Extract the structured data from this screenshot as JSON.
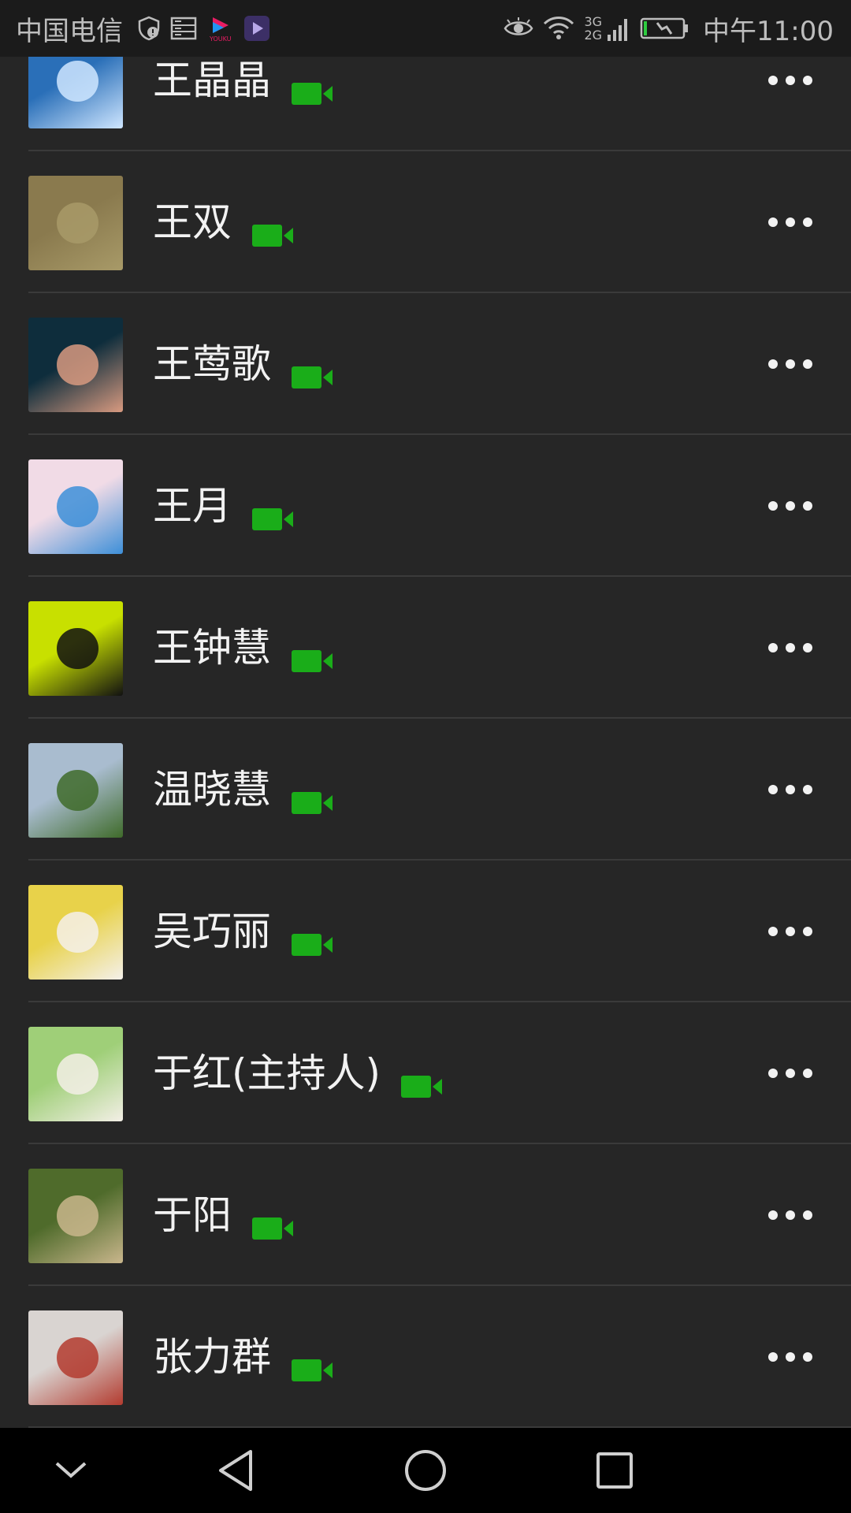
{
  "status_bar": {
    "carrier": "中国电信",
    "network_top": "3G",
    "network_bottom": "2G",
    "time": "中午11:00",
    "icons": [
      "shield-check-icon",
      "storage-icon",
      "youku-app-icon",
      "video-player-app-icon",
      "eye-icon",
      "wifi-icon",
      "signal-icon",
      "battery-charging-icon"
    ]
  },
  "contacts": [
    {
      "name": "王晶晶",
      "avatar": "sky-sun-avatar",
      "avatar_colors": [
        "#2a6fb8",
        "#cfe6ff"
      ]
    },
    {
      "name": "王双",
      "avatar": "grass-shadow-avatar",
      "avatar_colors": [
        "#8a7a4e",
        "#a89a68"
      ]
    },
    {
      "name": "王莺歌",
      "avatar": "fingers-hat-avatar",
      "avatar_colors": [
        "#0e2d3c",
        "#d89a80"
      ]
    },
    {
      "name": "王月",
      "avatar": "doraemon-avatar",
      "avatar_colors": [
        "#f1dbe6",
        "#3d8fd8"
      ]
    },
    {
      "name": "王钟慧",
      "avatar": "cartoon-girl-avatar",
      "avatar_colors": [
        "#c8e000",
        "#111111"
      ]
    },
    {
      "name": "温晓慧",
      "avatar": "sunflower-field-avatar",
      "avatar_colors": [
        "#a9bccf",
        "#3f6b2a"
      ]
    },
    {
      "name": "吴巧丽",
      "avatar": "kitten-flower-avatar",
      "avatar_colors": [
        "#e8d24a",
        "#f4f0ea"
      ]
    },
    {
      "name": "于红(主持人)",
      "avatar": "woman-white-dress-avatar",
      "avatar_colors": [
        "#9fcf78",
        "#f3efe6"
      ]
    },
    {
      "name": "于阳",
      "avatar": "tree-street-avatar",
      "avatar_colors": [
        "#4f6b2b",
        "#c9b68c"
      ]
    },
    {
      "name": "张力群",
      "avatar": "costume-woman-avatar",
      "avatar_colors": [
        "#d9d4d1",
        "#b33b2f"
      ]
    }
  ],
  "colors": {
    "accent_green": "#1aad19",
    "background": "#262626",
    "divider": "#3a3a3a"
  },
  "nav_bar": {
    "buttons": [
      "collapse-down-icon",
      "back-icon",
      "home-icon",
      "recents-icon"
    ]
  }
}
